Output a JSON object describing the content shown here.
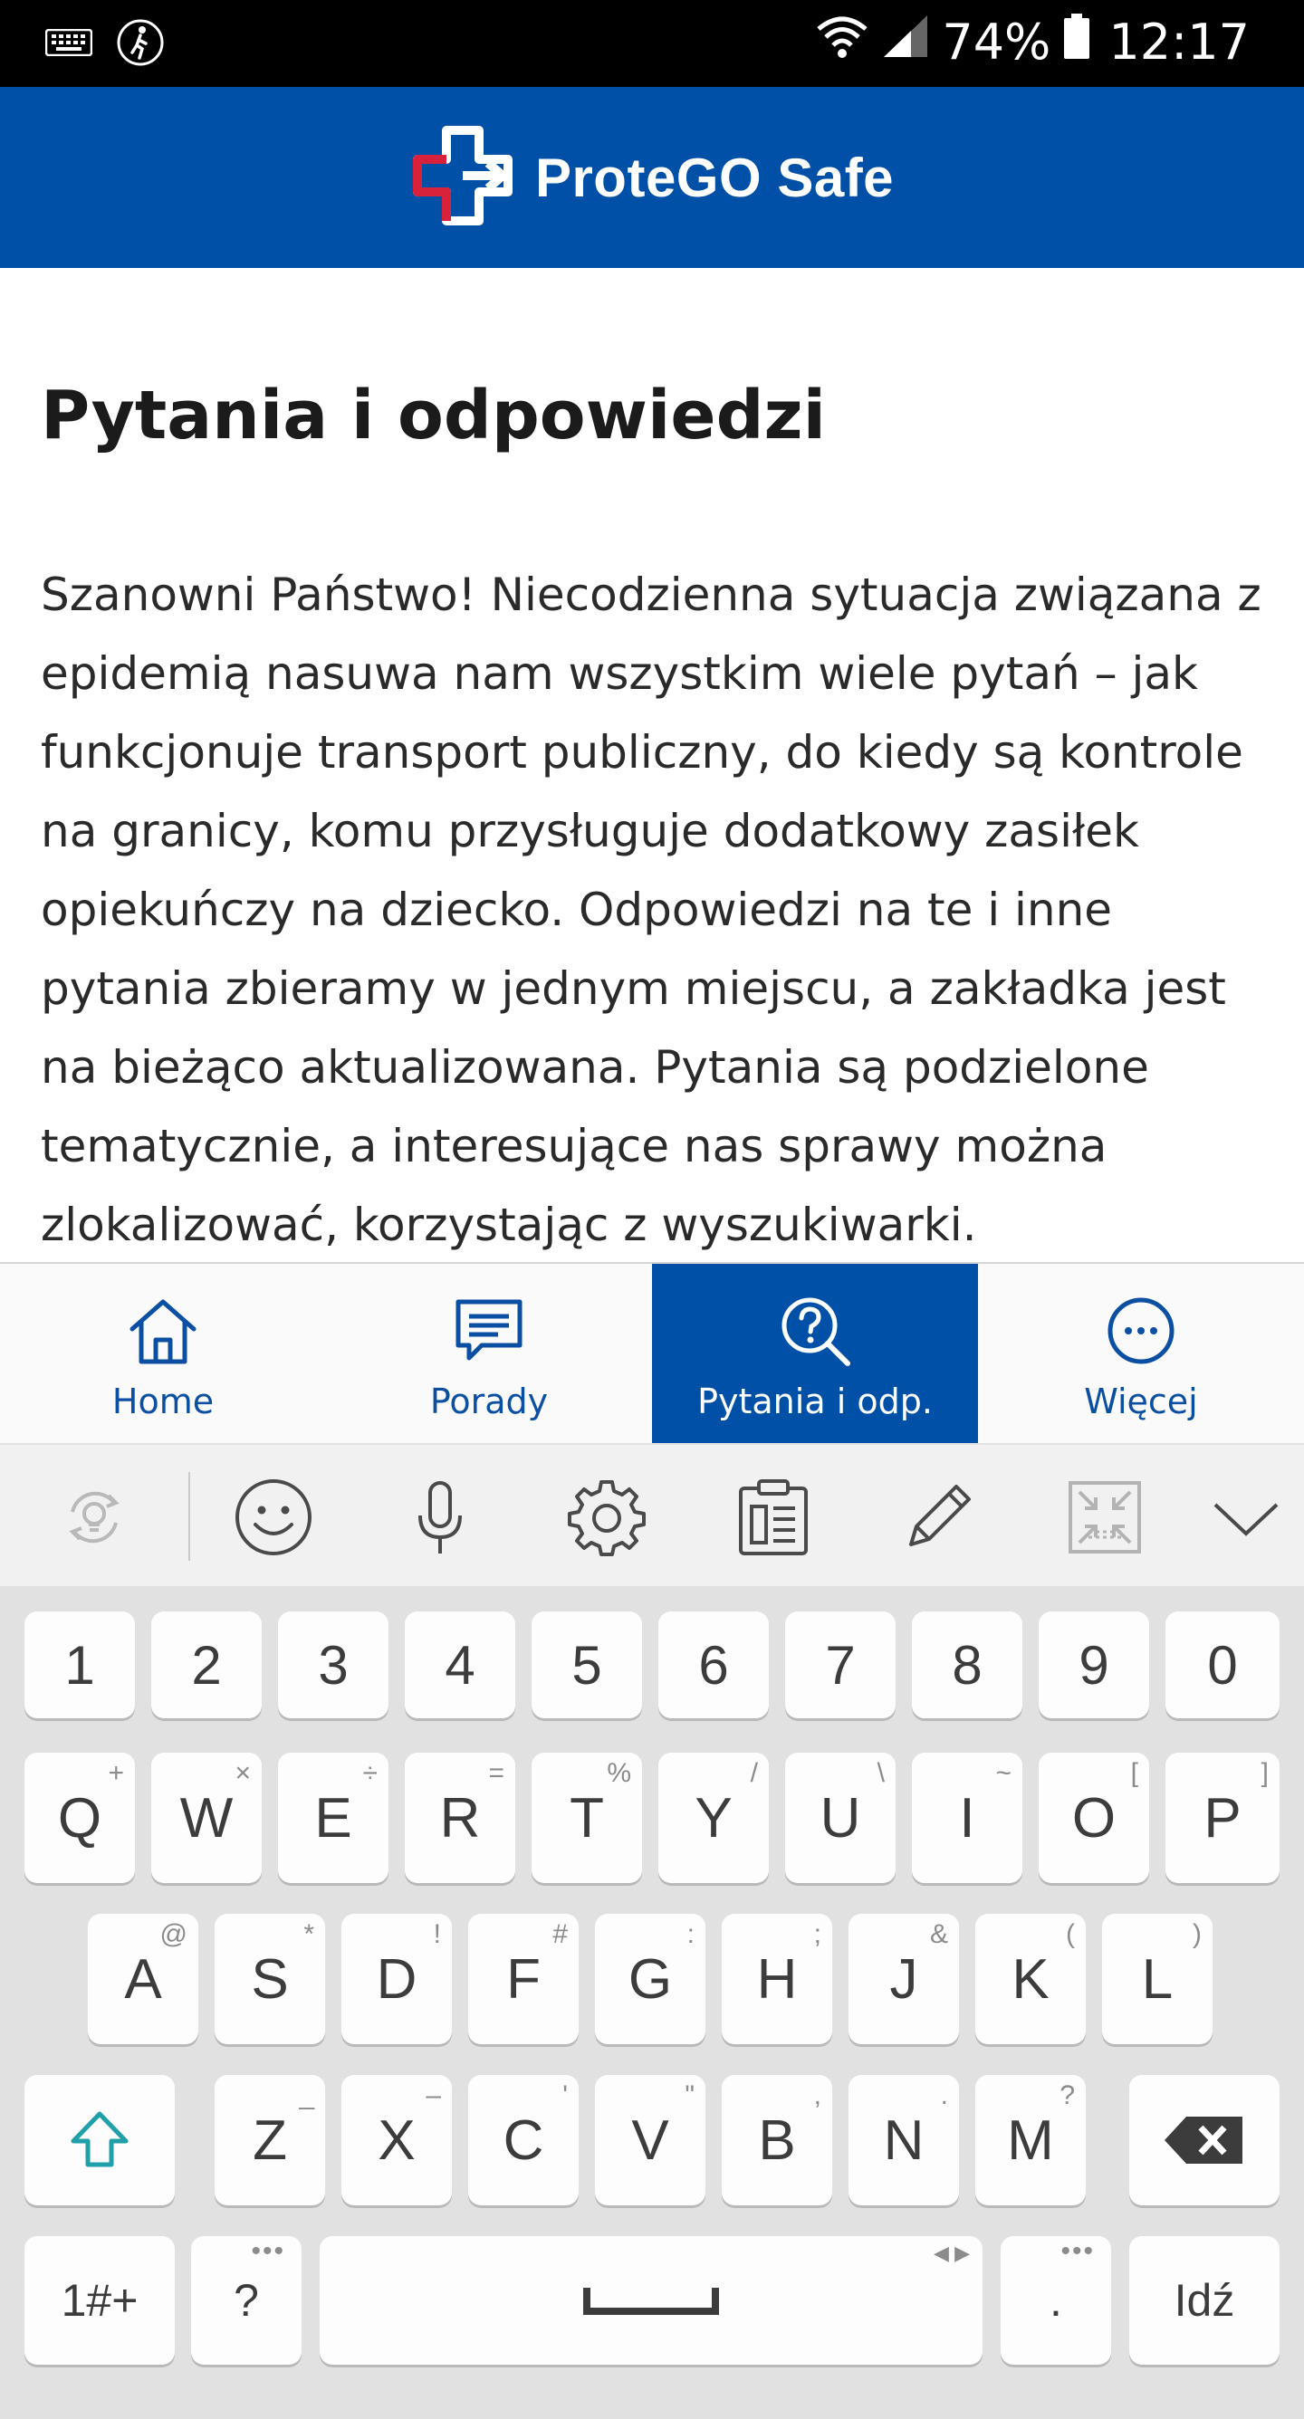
{
  "status_bar": {
    "battery": "74%",
    "time": "12:17",
    "icons": [
      "keyboard-icon",
      "walking-icon",
      "wifi-icon",
      "signal-icon",
      "battery-icon"
    ]
  },
  "app_bar": {
    "brand": "ProteGO Safe",
    "logo": "protego-cross-logo",
    "colors": {
      "bar": "#0050a8",
      "logo_red": "#d8213b"
    }
  },
  "content": {
    "title": "Pytania i odpowiedzi",
    "intro": "Szanowni Państwo! Niecodzienna sytuacja związana z epidemią nasuwa nam wszystkim wiele pytań – jak funkcjonuje transport publiczny, do kiedy są kontrole na granicy, komu przysługuje dodatkowy zasiłek opiekuńczy na dziecko. Odpowiedzi na te i inne pytania zbieramy w jednym miejscu, a zakładka jest na bieżąco aktualizowana. Pytania są podzielone tematycznie, a interesujące nas sprawy można zlokalizować, korzystając z wyszukiwarki."
  },
  "tab_bar": {
    "active": "Pytania i odp.",
    "tabs": [
      {
        "label": "Home",
        "icon": "home-icon"
      },
      {
        "label": "Porady",
        "icon": "chat-icon"
      },
      {
        "label": "Pytania i odp.",
        "icon": "question-search-icon"
      },
      {
        "label": "Więcej",
        "icon": "more-icon"
      }
    ]
  },
  "keyboard": {
    "toolbar": [
      "bulb-sync-icon",
      "emoji-icon",
      "microphone-icon",
      "gear-icon",
      "clipboard-icon",
      "pencil-icon",
      "resize-icon",
      "chevron-down-icon"
    ],
    "number_row": [
      "1",
      "2",
      "3",
      "4",
      "5",
      "6",
      "7",
      "8",
      "9",
      "0"
    ],
    "row1": [
      {
        "key": "Q",
        "sub": "+"
      },
      {
        "key": "W",
        "sub": "×"
      },
      {
        "key": "E",
        "sub": "÷"
      },
      {
        "key": "R",
        "sub": "="
      },
      {
        "key": "T",
        "sub": "%"
      },
      {
        "key": "Y",
        "sub": "/"
      },
      {
        "key": "U",
        "sub": "\\"
      },
      {
        "key": "I",
        "sub": "~"
      },
      {
        "key": "O",
        "sub": "["
      },
      {
        "key": "P",
        "sub": "]"
      }
    ],
    "row2": [
      {
        "key": "A",
        "sub": "@"
      },
      {
        "key": "S",
        "sub": "*"
      },
      {
        "key": "D",
        "sub": "!"
      },
      {
        "key": "F",
        "sub": "#"
      },
      {
        "key": "G",
        "sub": ":"
      },
      {
        "key": "H",
        "sub": ";"
      },
      {
        "key": "J",
        "sub": "&"
      },
      {
        "key": "K",
        "sub": "("
      },
      {
        "key": "L",
        "sub": ")"
      }
    ],
    "row3": [
      {
        "key": "Z",
        "sub": "_"
      },
      {
        "key": "X",
        "sub": "–"
      },
      {
        "key": "C",
        "sub": "'"
      },
      {
        "key": "V",
        "sub": "\""
      },
      {
        "key": "B",
        "sub": ","
      },
      {
        "key": "N",
        "sub": "."
      },
      {
        "key": "M",
        "sub": "?"
      }
    ],
    "symbols": "1#+",
    "question": "?",
    "period": ".",
    "go": "Idź",
    "shift_color": "#1fa0a8"
  }
}
